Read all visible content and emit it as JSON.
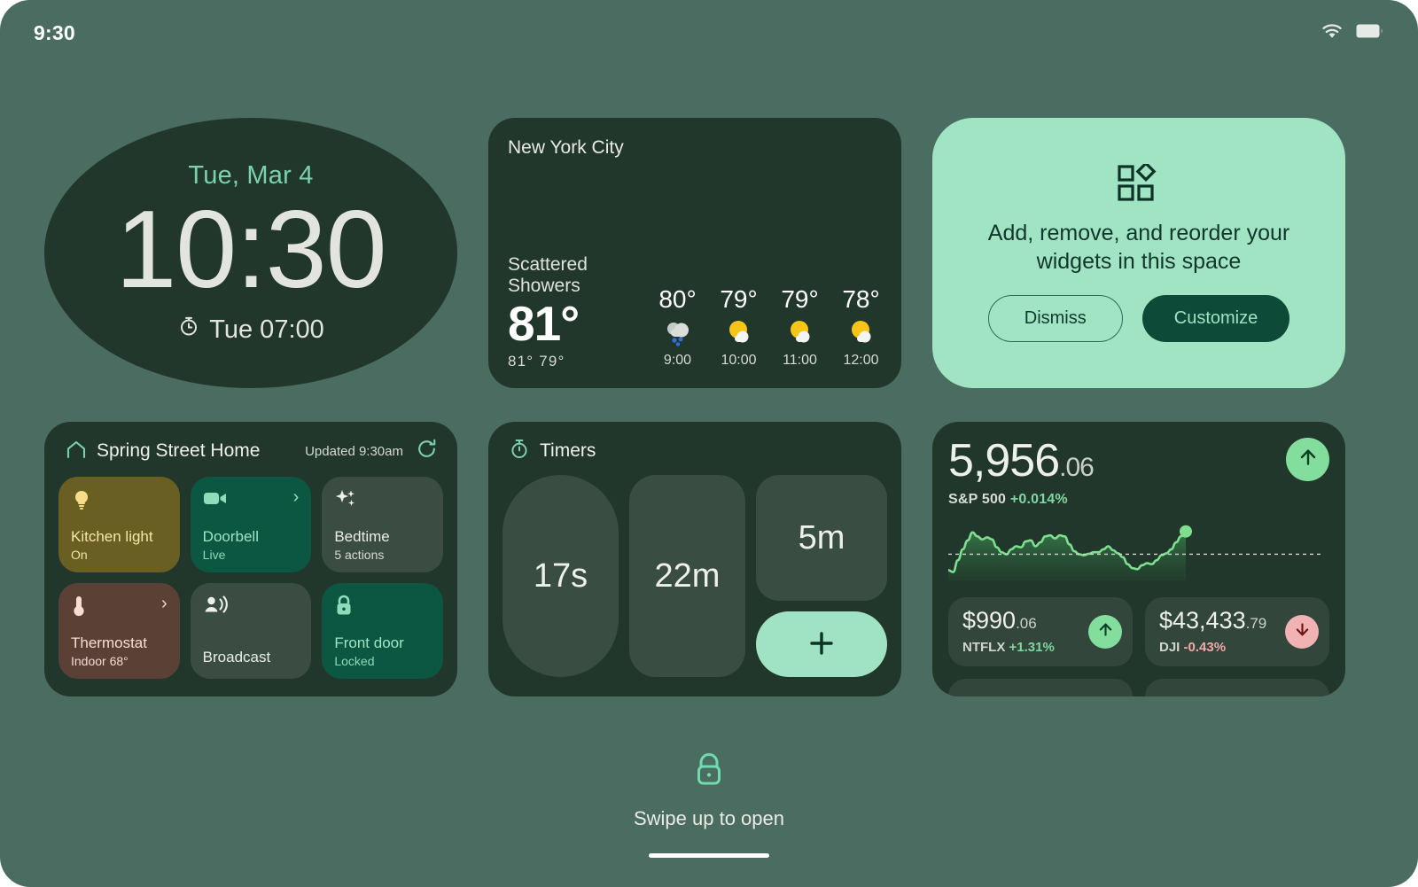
{
  "status_bar": {
    "time": "9:30",
    "icons": [
      "wifi-icon",
      "battery-icon"
    ]
  },
  "clock_widget": {
    "date": "Tue, Mar 4",
    "time": "10:30",
    "alarm": "Tue 07:00",
    "alarm_icon": "alarm-icon"
  },
  "weather_widget": {
    "city": "New York City",
    "condition": "Scattered Showers",
    "current_temp": "81°",
    "high_low": "81°  79°",
    "hourly": [
      {
        "temp": "80°",
        "icon": "rain-cloud-icon",
        "time": "9:00"
      },
      {
        "temp": "79°",
        "icon": "sun-behind-cloud-icon",
        "time": "10:00"
      },
      {
        "temp": "79°",
        "icon": "sun-behind-cloud-icon",
        "time": "11:00"
      },
      {
        "temp": "78°",
        "icon": "sun-behind-cloud-icon",
        "time": "12:00"
      }
    ]
  },
  "customize_widget": {
    "icon": "widgets-icon",
    "message": "Add, remove, and reorder your widgets in this space",
    "dismiss_label": "Dismiss",
    "customize_label": "Customize"
  },
  "home_widget": {
    "icon": "home-icon",
    "title": "Spring Street Home",
    "updated": "Updated 9:30am",
    "refresh_icon": "refresh-icon",
    "tiles": [
      {
        "name": "Kitchen light",
        "state": "On",
        "icon": "lightbulb-icon",
        "chevron": "",
        "color": "#6a5f22"
      },
      {
        "name": "Doorbell",
        "state": "Live",
        "icon": "video-camera-icon",
        "chevron": "›",
        "color": "#0c5742"
      },
      {
        "name": "Bedtime",
        "state": "5 actions",
        "icon": "sparkle-icon",
        "chevron": "",
        "color": "#3b4d43"
      },
      {
        "name": "Thermostat",
        "state": "Indoor 68°",
        "icon": "thermometer-icon",
        "chevron": "›",
        "color": "#5b4035"
      },
      {
        "name": "Broadcast",
        "state": "",
        "icon": "broadcast-icon",
        "chevron": "",
        "color": "#3b4d43"
      },
      {
        "name": "Front door",
        "state": "Locked",
        "icon": "lock-icon",
        "chevron": "",
        "color": "#0c5742"
      }
    ]
  },
  "timers_widget": {
    "icon": "stopwatch-icon",
    "title": "Timers",
    "timers": [
      "17s",
      "22m",
      "5m"
    ],
    "add_label": "+",
    "add_icon": "plus-icon"
  },
  "stocks_widget": {
    "index": {
      "value": "5,956",
      "cents": ".06",
      "label": "S&P 500",
      "change": "+0.014%",
      "direction": "up",
      "arrow_icon": "arrow-up-icon"
    },
    "cards": [
      {
        "price": "$990",
        "cents": ".06",
        "symbol": "NTFLX",
        "change": "+1.31%",
        "direction": "up",
        "arrow_icon": "arrow-up-icon"
      },
      {
        "price": "$43,433",
        "cents": ".79",
        "symbol": "DJI",
        "change": "-0.43%",
        "direction": "down",
        "arrow_icon": "arrow-down-icon"
      }
    ],
    "chart_data": {
      "type": "area",
      "title": "S&P 500 intraday sparkline",
      "xlabel": "",
      "ylabel": "",
      "grid": false,
      "legend": null,
      "baseline": 0.42,
      "values": [
        0.1,
        0.06,
        0.3,
        0.52,
        0.7,
        0.86,
        0.78,
        0.72,
        0.76,
        0.72,
        0.56,
        0.46,
        0.42,
        0.52,
        0.58,
        0.56,
        0.68,
        0.7,
        0.58,
        0.66,
        0.78,
        0.8,
        0.74,
        0.8,
        0.78,
        0.62,
        0.48,
        0.42,
        0.4,
        0.43,
        0.46,
        0.46,
        0.52,
        0.58,
        0.5,
        0.44,
        0.36,
        0.22,
        0.14,
        0.12,
        0.2,
        0.24,
        0.22,
        0.3,
        0.4,
        0.44,
        0.52,
        0.66,
        0.78,
        0.88
      ],
      "ylim": [
        0,
        1
      ],
      "last_point_marker": true
    }
  },
  "bottom": {
    "lock_icon": "lock-icon",
    "swipe_text": "Swipe up to open"
  },
  "colors": {
    "background": "#4a6c61",
    "widget_surface": "#22372b",
    "accent_light": "#9fe3c4",
    "accent_dark": "#0d4a38",
    "up_green": "#7fd79f",
    "down_red": "#f0a9a9"
  }
}
